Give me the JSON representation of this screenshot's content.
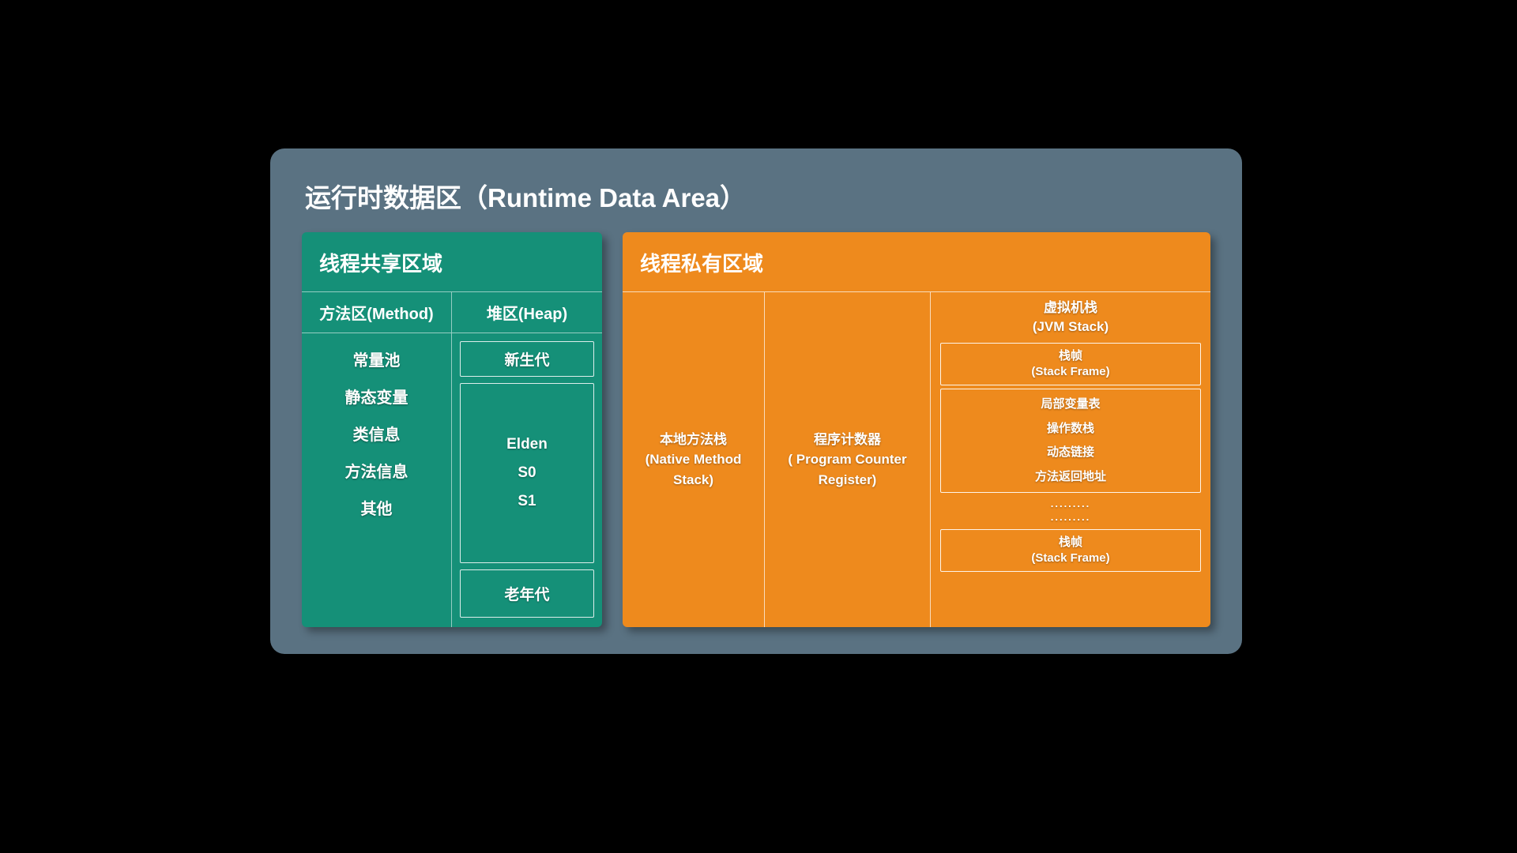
{
  "title": "运行时数据区（Runtime Data Area）",
  "shared": {
    "header": "线程共享区域",
    "method": {
      "label": "方法区(Method)",
      "items": [
        "常量池",
        "静态变量",
        "类信息",
        "方法信息",
        "其他"
      ]
    },
    "heap": {
      "label": "堆区(Heap)",
      "newgen": "新生代",
      "elden": [
        "Elden",
        "S0",
        "S1"
      ],
      "oldgen": "老年代"
    }
  },
  "private": {
    "header": "线程私有区域",
    "native": {
      "l1": "本地方法栈",
      "l2": "(Native Method Stack)"
    },
    "pc": {
      "l1": "程序计数器",
      "l2": "( Program Counter Register)"
    },
    "jvmstack": {
      "l1": "虚拟机栈",
      "l2": "(JVM Stack)",
      "frame": {
        "l1": "栈帧",
        "l2": "(Stack Frame)"
      },
      "detail": [
        "局部变量表",
        "操作数栈",
        "动态链接",
        "方法返回地址"
      ],
      "dots": ".........",
      "frame2": {
        "l1": "栈帧",
        "l2": "(Stack Frame)"
      }
    }
  }
}
